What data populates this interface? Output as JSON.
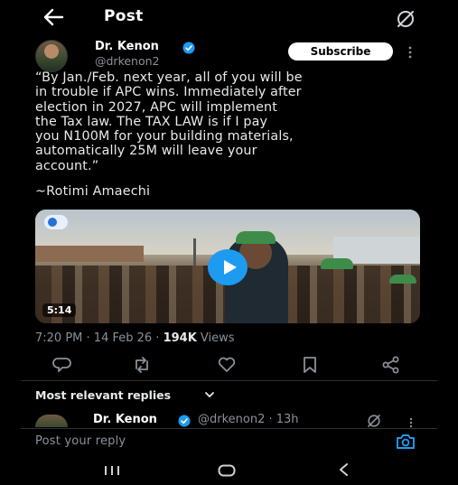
{
  "header": {
    "title": "Post"
  },
  "author": {
    "name": "Dr. Kenon",
    "handle": "@drkenon2",
    "subscribe_label": "Subscribe"
  },
  "tweet": {
    "text": "“By Jan./Feb. next year, all of you will be\nin trouble if APC wins. Immediately after\nelection in 2027, APC will implement\nthe Tax law. The TAX LAW is if I pay\nyou N100M for your building materials,\nautomatically 25M will leave your\naccount.”",
    "attribution": "~Rotimi Amaechi"
  },
  "video": {
    "duration": "5:14"
  },
  "meta": {
    "time": "7:20 PM",
    "separator": " · ",
    "date": "14 Feb 26",
    "views_count": "194K",
    "views_label": " Views"
  },
  "replies": {
    "sort_label": "Most relevant replies",
    "first_reply": {
      "name": "Dr. Kenon",
      "handle_time": "@drkenon2 · 13h"
    }
  },
  "composer": {
    "placeholder": "Post your reply"
  },
  "icons": {
    "back": "arrow-left-icon",
    "grok": "slash-circle-icon",
    "verified": "verified-badge-icon",
    "reply": "comment-icon",
    "repost": "repost-icon",
    "like": "heart-icon",
    "bookmark": "bookmark-icon",
    "share": "share-icon",
    "camera": "camera-icon"
  },
  "colors": {
    "accent": "#1d9bf0",
    "background": "#000000",
    "muted": "#8a9199"
  }
}
